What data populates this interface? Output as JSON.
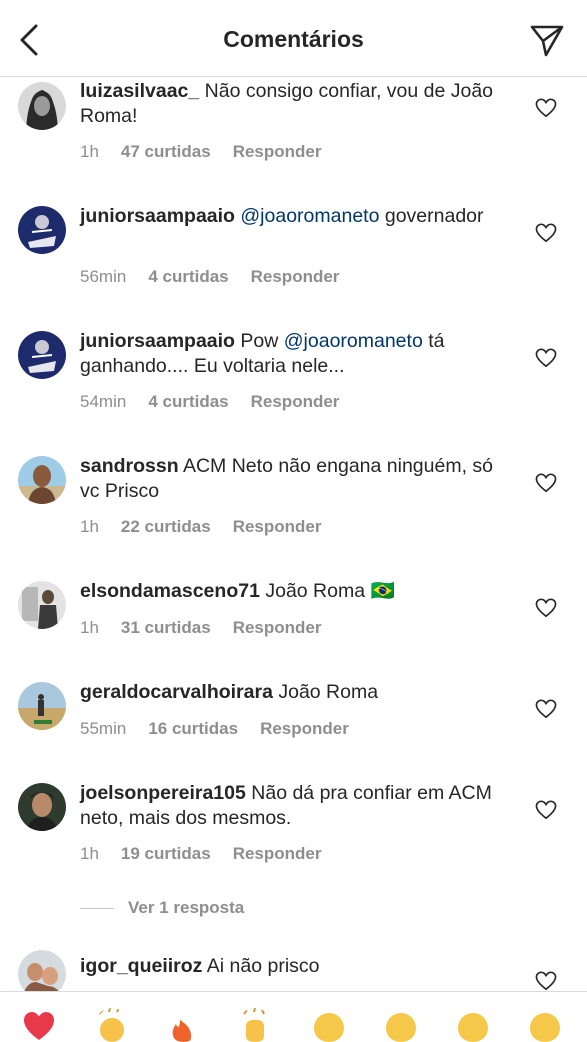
{
  "header": {
    "title": "Comentários",
    "back_icon": "chevron-left-icon",
    "send_icon": "paper-plane-icon"
  },
  "comments": [
    {
      "username": "luizasilvaac_",
      "text": "Não consigo confiar, vou de João Roma!",
      "time": "1h",
      "likes": "47 curtidas",
      "reply": "Responder"
    },
    {
      "username": "juniorsaampaaio",
      "mention": "@joaoromaneto",
      "text": "governador",
      "time": "56min",
      "likes": "4 curtidas",
      "reply": "Responder"
    },
    {
      "username": "juniorsaampaaio",
      "prefix": "Pow",
      "mention": "@joaoromaneto",
      "text": "tá ganhando.... Eu voltaria nele...",
      "time": "54min",
      "likes": "4 curtidas",
      "reply": "Responder"
    },
    {
      "username": "sandrossn",
      "text": "ACM Neto não engana ninguém, só vc Prisco",
      "time": "1h",
      "likes": "22 curtidas",
      "reply": "Responder"
    },
    {
      "username": "elsondamasceno71",
      "text": "João Roma",
      "flag": "🇧🇷",
      "time": "1h",
      "likes": "31 curtidas",
      "reply": "Responder"
    },
    {
      "username": "geraldocarvalhoirara",
      "text": "João Roma",
      "time": "55min",
      "likes": "16 curtidas",
      "reply": "Responder"
    },
    {
      "username": "joelsonpereira105",
      "text": "Não dá pra confiar em ACM neto, mais dos mesmos.",
      "time": "1h",
      "likes": "19 curtidas",
      "reply": "Responder"
    },
    {
      "username": "igor_queiiroz",
      "text": "Ai não prisco"
    }
  ],
  "view_replies": "Ver 1 resposta",
  "colors": {
    "text": "#262626",
    "secondary": "#8e8e8e",
    "mention": "#00376b",
    "divider": "#dbdbdb"
  }
}
